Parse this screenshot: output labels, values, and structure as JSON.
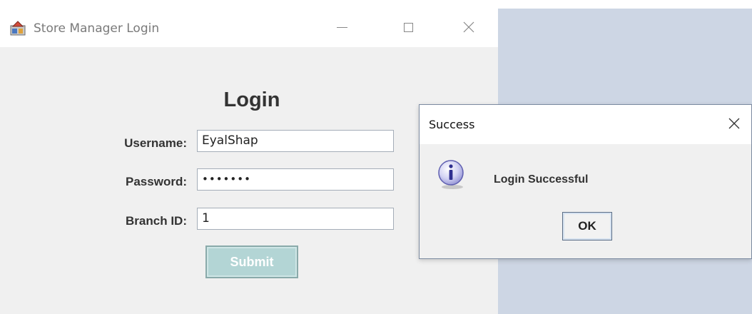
{
  "main_window": {
    "title": "Store Manager Login",
    "icons": {
      "app": "java-app-icon",
      "minimize": "minimize-icon",
      "maximize": "maximize-icon",
      "close": "close-icon"
    }
  },
  "login_form": {
    "heading": "Login",
    "username_label": "Username:",
    "username_value": "EyalShap",
    "password_label": "Password:",
    "password_masked": "•••••••",
    "branch_label": "Branch ID:",
    "branch_value": "1",
    "submit_label": "Submit"
  },
  "dialog": {
    "title": "Success",
    "message": "Login Successful",
    "ok_label": "OK",
    "icons": {
      "info": "info-icon",
      "close": "close-icon"
    }
  },
  "colors": {
    "window_bg": "#f0f0f0",
    "desktop_bg": "#cdd6e4",
    "submit_bg": "#b3d5d5",
    "text": "#333333"
  }
}
